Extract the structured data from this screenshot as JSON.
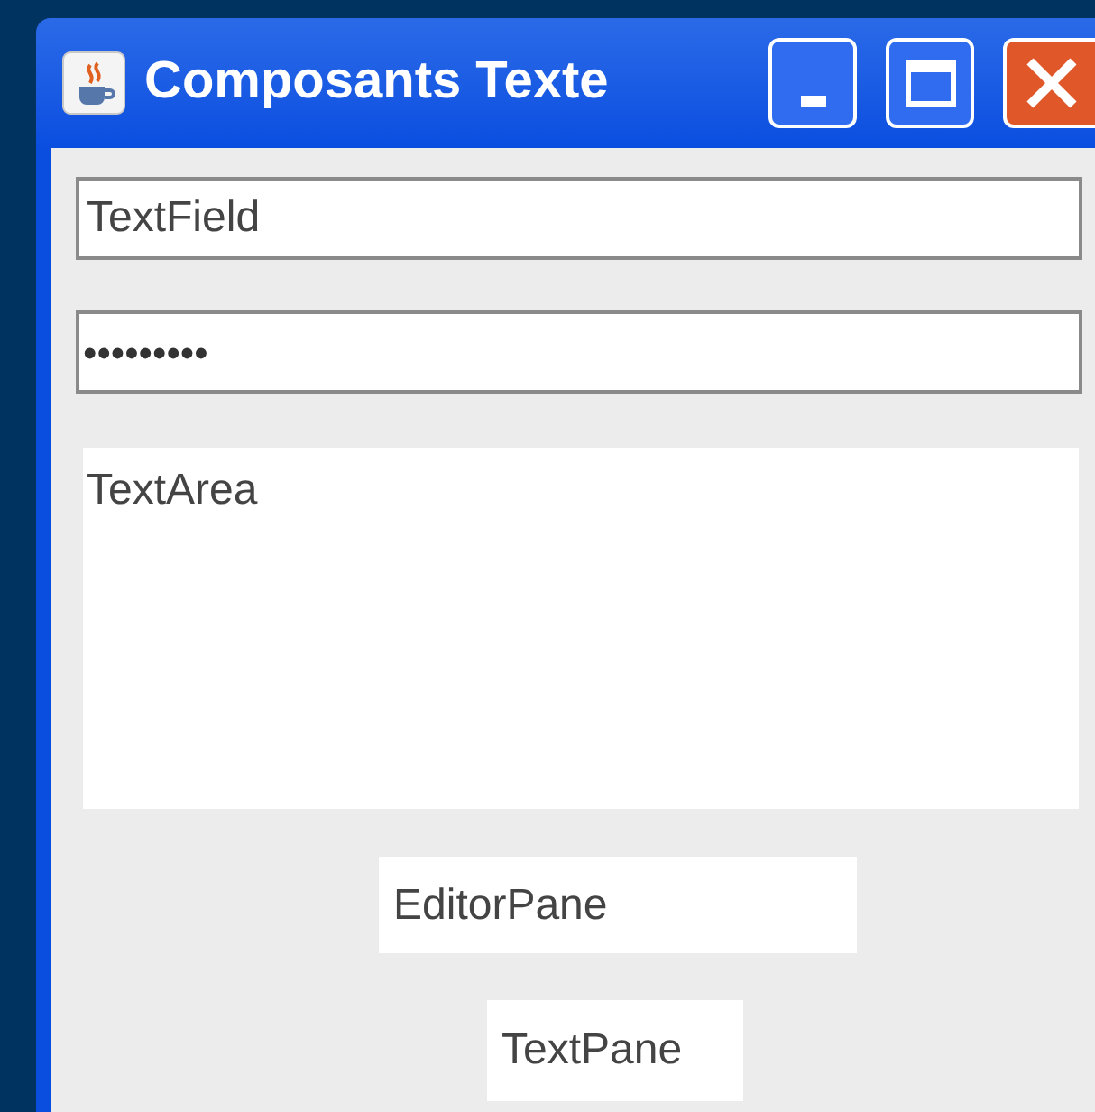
{
  "window": {
    "title": "Composants Texte"
  },
  "text_field": {
    "value": "TextField"
  },
  "password_field": {
    "value": "•••••••••"
  },
  "text_area": {
    "value": "TextArea"
  },
  "editor_pane": {
    "value": "EditorPane"
  },
  "text_pane": {
    "value": "TextPane"
  }
}
